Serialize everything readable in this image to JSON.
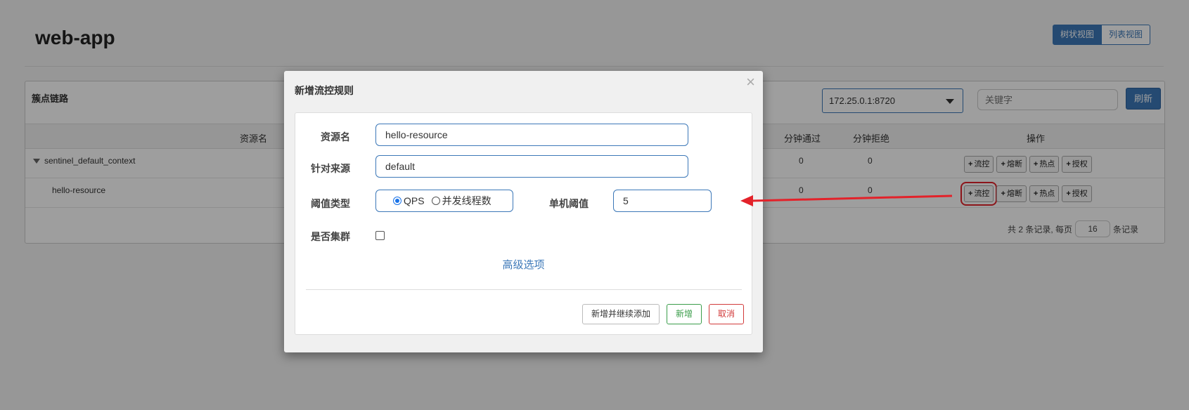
{
  "page": {
    "app_name": "web-app"
  },
  "view_toggle": {
    "tree_label": "树状视图",
    "list_label": "列表视图"
  },
  "panel": {
    "title": "簇点链路",
    "machine": "172.25.0.1:8720",
    "keyword_placeholder": "关键字",
    "refresh_label": "刷新"
  },
  "table": {
    "headers": {
      "resource": "资源名",
      "pass_min": "分钟通过",
      "block_min": "分钟拒绝",
      "ops": "操作"
    },
    "rows": [
      {
        "name": "sentinel_default_context",
        "pass": "0",
        "block": "0"
      },
      {
        "name": "hello-resource",
        "pass": "0",
        "block": "0"
      }
    ],
    "ops": {
      "flow": "流控",
      "degrade": "熔断",
      "hot": "热点",
      "auth": "授权"
    }
  },
  "pagination": {
    "prefix": "共 2 条记录, 每页",
    "page_size": "16",
    "suffix": "条记录"
  },
  "modal": {
    "title": "新增流控规则",
    "close": "×",
    "resource_label": "资源名",
    "resource_value": "hello-resource",
    "origin_label": "针对来源",
    "origin_value": "default",
    "grade_label": "阈值类型",
    "grade_options": [
      "QPS",
      "并发线程数"
    ],
    "threshold_label": "单机阈值",
    "threshold_value": "5",
    "cluster_label": "是否集群",
    "advanced_label": "高级选项",
    "btn_add_continue": "新增并继续添加",
    "btn_add": "新增",
    "btn_cancel": "取消"
  },
  "colors": {
    "primary": "#3c78b8",
    "success": "#3a9d4a",
    "danger": "#d23a3a",
    "annotation": "#e3222a"
  }
}
